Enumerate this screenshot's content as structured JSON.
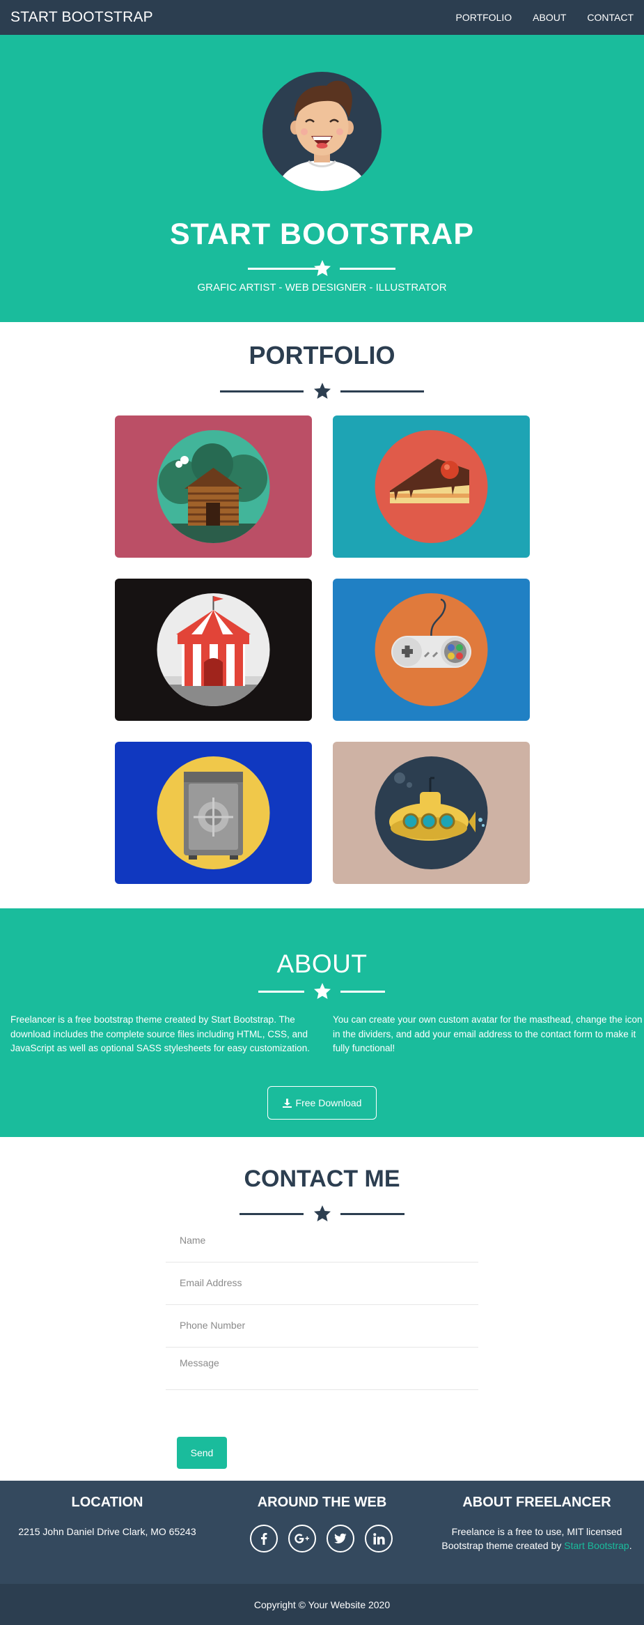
{
  "nav": {
    "brand": "START BOOTSTRAP",
    "links": [
      "PORTFOLIO",
      "ABOUT",
      "CONTACT"
    ]
  },
  "masthead": {
    "title": "START BOOTSTRAP",
    "subtitle": "GRAFIC ARTIST - WEB DESIGNER - ILLUSTRATOR"
  },
  "portfolio": {
    "title": "PORTFOLIO",
    "items": [
      {
        "icon": "cabin-icon",
        "bg": "#bb4f66"
      },
      {
        "icon": "cake-icon",
        "bg": "#1ea4b4"
      },
      {
        "icon": "circus-tent-icon",
        "bg": "#161212"
      },
      {
        "icon": "game-controller-icon",
        "bg": "#2080c4"
      },
      {
        "icon": "safe-icon",
        "bg": "#1038c0"
      },
      {
        "icon": "submarine-icon",
        "bg": "#ceb2a4"
      }
    ]
  },
  "about": {
    "title": "ABOUT",
    "left_text": "Freelancer is a free bootstrap theme created by Start Bootstrap. The download includes the complete source files including HTML, CSS, and JavaScript as well as optional SASS stylesheets for easy customization.",
    "right_text": "You can create your own custom avatar for the masthead, change the icon in the dividers, and add your email address to the contact form to make it fully functional!",
    "download_label": "Free Download"
  },
  "contact": {
    "title": "CONTACT ME",
    "name_placeholder": "Name",
    "email_placeholder": "Email Address",
    "phone_placeholder": "Phone Number",
    "message_placeholder": "Message",
    "send_label": "Send"
  },
  "footer": {
    "location_title": "LOCATION",
    "location_text": "2215 John Daniel Drive Clark, MO 65243",
    "web_title": "AROUND THE WEB",
    "social": [
      "facebook-icon",
      "google-plus-icon",
      "twitter-icon",
      "linkedin-icon"
    ],
    "about_title": "ABOUT FREELANCER",
    "about_text_1": "Freelance is a free to use, MIT licensed Bootstrap theme created by",
    "about_link": "Start Bootstrap",
    "about_text_2": ".",
    "copyright": "Copyright © Your Website 2020"
  },
  "colors": {
    "primary": "#1abc9c",
    "dark": "#2c3e50",
    "footer": "#34495e"
  }
}
